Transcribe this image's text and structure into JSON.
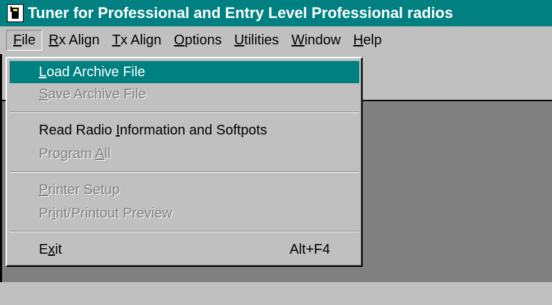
{
  "window": {
    "title": "Tuner for Professional and Entry Level Professional radios"
  },
  "menubar": {
    "items": [
      {
        "label": "File",
        "mnemonic_index": 0
      },
      {
        "label": "Rx Align",
        "mnemonic_index": 0
      },
      {
        "label": "Tx Align",
        "mnemonic_index": 0
      },
      {
        "label": "Options",
        "mnemonic_index": 0
      },
      {
        "label": "Utilities",
        "mnemonic_index": 0
      },
      {
        "label": "Window",
        "mnemonic_index": 0
      },
      {
        "label": "Help",
        "mnemonic_index": 0
      }
    ]
  },
  "file_menu": {
    "items": [
      {
        "label": "Load Archive File",
        "mnemonic_index": 0,
        "enabled": true,
        "highlighted": true
      },
      {
        "label": "Save Archive File",
        "mnemonic_index": 0,
        "enabled": false
      },
      {
        "label": "Read Radio Information and Softpots",
        "mnemonic_index": 11,
        "enabled": true
      },
      {
        "label": "Program All",
        "mnemonic_index": 8,
        "enabled": false
      },
      {
        "label": "Printer Setup",
        "mnemonic_index": 0,
        "enabled": false
      },
      {
        "label": "Print/Printout Preview",
        "mnemonic_index": 2,
        "enabled": false
      },
      {
        "label": "Exit",
        "mnemonic_index": 1,
        "enabled": true,
        "shortcut": "Alt+F4"
      }
    ]
  },
  "colors": {
    "title_bar": "#008080",
    "highlight": "#008080",
    "face": "#c0c0c0",
    "workspace": "#808080"
  },
  "icons": {
    "app_icon": "radio-tuner-icon"
  }
}
